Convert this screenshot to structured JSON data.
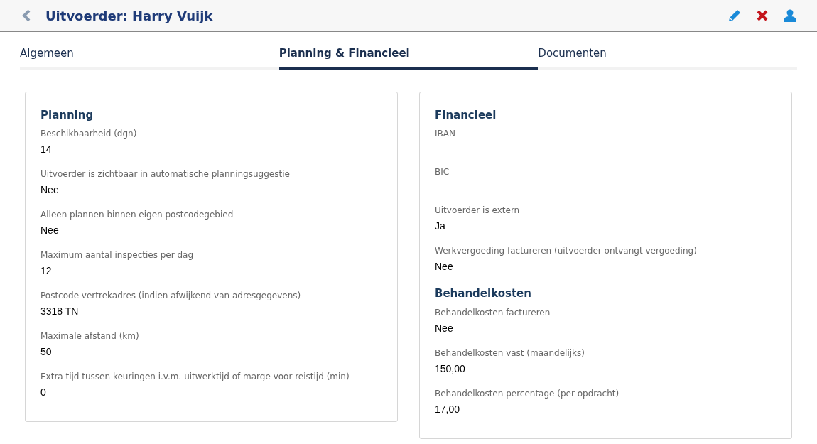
{
  "header": {
    "title": "Uitvoerder: Harry Vuijk"
  },
  "tabs": [
    {
      "label": "Algemeen",
      "selected": false
    },
    {
      "label": "Planning & Financieel",
      "selected": true
    },
    {
      "label": "Documenten",
      "selected": false
    }
  ],
  "cards": [
    {
      "sections": [
        {
          "title": "Planning",
          "fields": [
            {
              "label": "Beschikbaarheid (dgn)",
              "value": "14"
            },
            {
              "label": "Uitvoerder is zichtbaar in automatische planningsuggestie",
              "value": "Nee"
            },
            {
              "label": "Alleen plannen binnen eigen postcodegebied",
              "value": "Nee"
            },
            {
              "label": "Maximum aantal inspecties per dag",
              "value": "12"
            },
            {
              "label": "Postcode vertrekadres (indien afwijkend van adresgegevens)",
              "value": "3318 TN"
            },
            {
              "label": "Maximale afstand (km)",
              "value": "50"
            },
            {
              "label": "Extra tijd tussen keuringen i.v.m. uitwerktijd of marge voor reistijd (min)",
              "value": "0"
            }
          ]
        }
      ]
    },
    {
      "sections": [
        {
          "title": "Financieel",
          "fields": [
            {
              "label": "IBAN"
            },
            {
              "label": "BIC"
            },
            {
              "label": "Uitvoerder is extern",
              "value": "Ja"
            },
            {
              "label": "Werkvergoeding factureren (uitvoerder ontvangt vergoeding)",
              "value": "Nee"
            }
          ]
        },
        {
          "title": "Behandelkosten",
          "fields": [
            {
              "label": "Behandelkosten factureren",
              "value": "Nee"
            },
            {
              "label": "Behandelkosten vast (maandelijks)",
              "value": "150,00"
            },
            {
              "label": "Behandelkosten percentage (per opdracht)",
              "value": "17,00"
            }
          ]
        }
      ]
    }
  ]
}
